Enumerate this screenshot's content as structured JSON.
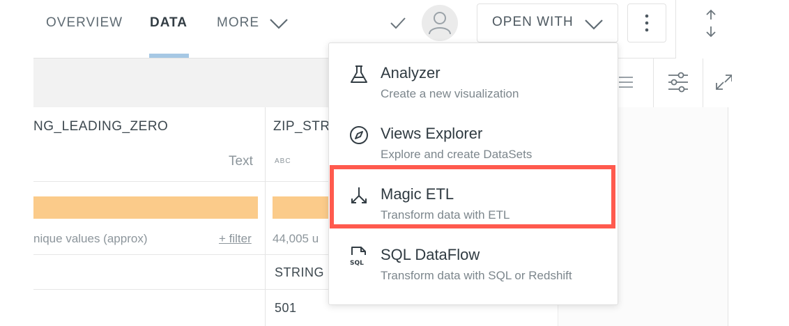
{
  "nav": {
    "tabs": [
      {
        "label": "OVERVIEW"
      },
      {
        "label": "DATA"
      },
      {
        "label": "MORE"
      }
    ],
    "open_with_label": "OPEN WITH"
  },
  "table": {
    "columns": [
      {
        "header": "NG_LEADING_ZERO",
        "type_label": "Text",
        "stats": "nique values (approx)",
        "filter_label": "+ filter"
      },
      {
        "header": "ZIP_STRI",
        "type_label": "ABC",
        "stats": "44,005 u"
      }
    ],
    "rows": [
      {
        "col2": "STRING"
      },
      {
        "col2": "501"
      }
    ]
  },
  "dropdown": {
    "items": [
      {
        "title": "Analyzer",
        "subtitle": "Create a new visualization",
        "icon": "flask-icon"
      },
      {
        "title": "Views Explorer",
        "subtitle": "Explore and create DataSets",
        "icon": "compass-icon"
      },
      {
        "title": "Magic ETL",
        "subtitle": "Transform data with ETL",
        "icon": "etl-branch-icon"
      },
      {
        "title": "SQL DataFlow",
        "subtitle": "Transform data with SQL or Redshift",
        "icon": "sql-file-icon"
      }
    ],
    "highlighted_item": "Magic ETL"
  },
  "colors": {
    "accent_underline": "#a6c8e4",
    "bar_fill": "#fbcb8a",
    "highlight_border": "#ff5a4e"
  }
}
